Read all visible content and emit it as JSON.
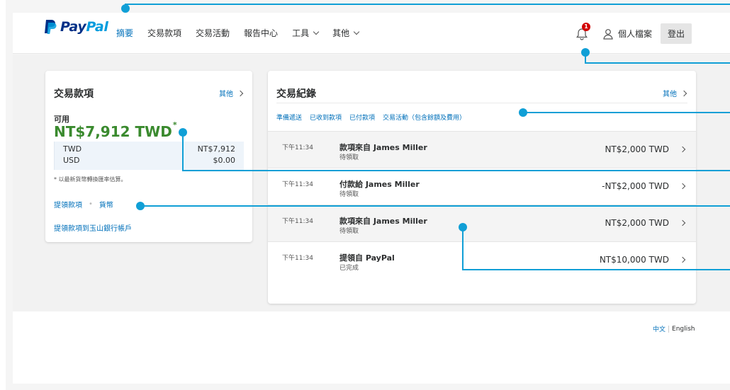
{
  "header": {
    "brand_word1": "Pay",
    "brand_word2": "Pal",
    "nav": [
      {
        "label": "摘要",
        "active": true
      },
      {
        "label": "交易款項"
      },
      {
        "label": "交易活動"
      },
      {
        "label": "報告中心"
      },
      {
        "label": "工具",
        "dropdown": true
      },
      {
        "label": "其他",
        "dropdown": true
      }
    ],
    "notification_count": "1",
    "profile_label": "個人檔案",
    "logout_label": "登出"
  },
  "funds_card": {
    "title": "交易款項",
    "more_label": "其他",
    "available_label": "可用",
    "balance": "NT$7,912 TWD",
    "balance_mark": "*",
    "currencies": [
      {
        "code": "TWD",
        "amount": "NT$7,912"
      },
      {
        "code": "USD",
        "amount": "$0.00"
      }
    ],
    "note": "* 以最新貨幣轉換匯率估算。",
    "link_withdraw": "提領款項",
    "link_currency": "貨幣",
    "link_bank": "提領款項到玉山銀行帳戶"
  },
  "activity_card": {
    "title": "交易紀錄",
    "more_label": "其他",
    "tabs": [
      "準備遞送",
      "已收到款項",
      "已付款項",
      "交易活動（包含餘額及費用）"
    ],
    "transactions": [
      {
        "time": "下午11:34",
        "name": "款項來自 James Miller",
        "status": "待領取",
        "amount": "NT$2,000 TWD"
      },
      {
        "time": "下午11:34",
        "name": "付款給 James Miller",
        "status": "待領取",
        "amount": "-NT$2,000 TWD"
      },
      {
        "time": "下午11:34",
        "name": "款項來自 James Miller",
        "status": "待領取",
        "amount": "NT$2,000 TWD"
      },
      {
        "time": "下午11:34",
        "name": "提領自 PayPal",
        "status": "已完成",
        "amount": "NT$10,000 TWD"
      }
    ]
  },
  "footer": {
    "lang_zh": "中文",
    "lang_en": "English"
  },
  "colors": {
    "brand_dark": "#003087",
    "brand_light": "#009cde",
    "link": "#0070ba",
    "balance_green": "#3a8a2e",
    "callout": "#109fd6",
    "badge": "#d20000"
  }
}
